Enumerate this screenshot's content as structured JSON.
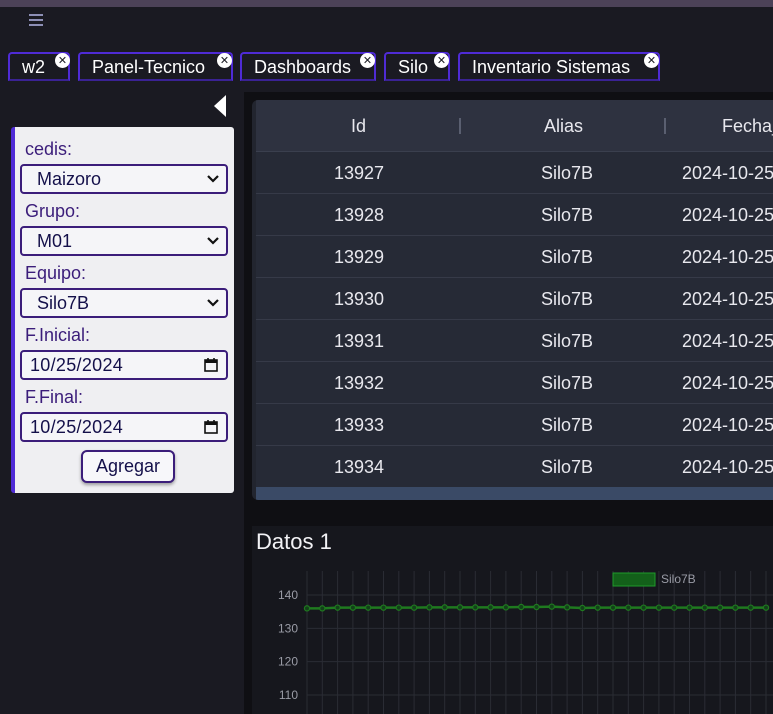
{
  "tabs": [
    {
      "label": "w2"
    },
    {
      "label": "Panel-Tecnico"
    },
    {
      "label": "Dashboards"
    },
    {
      "label": "Silo"
    },
    {
      "label": "Inventario Sistemas"
    }
  ],
  "filters": {
    "cedis_label": "cedis:",
    "cedis_value": "Maizoro",
    "grupo_label": "Grupo:",
    "grupo_value": "M01",
    "equipo_label": "Equipo:",
    "equipo_value": "Silo7B",
    "f_inicial_label": "F.Inicial:",
    "f_inicial_value": "10/25/2024",
    "f_final_label": "F.Final:",
    "f_final_value": "10/25/2024",
    "agregar_label": "Agregar"
  },
  "grid": {
    "columns": [
      "Id",
      "Alias",
      "Fecha_"
    ],
    "rows": [
      [
        "13927",
        "Silo7B",
        "2024-10-25"
      ],
      [
        "13928",
        "Silo7B",
        "2024-10-25"
      ],
      [
        "13929",
        "Silo7B",
        "2024-10-25"
      ],
      [
        "13930",
        "Silo7B",
        "2024-10-25"
      ],
      [
        "13931",
        "Silo7B",
        "2024-10-25"
      ],
      [
        "13932",
        "Silo7B",
        "2024-10-25"
      ],
      [
        "13933",
        "Silo7B",
        "2024-10-25"
      ],
      [
        "13934",
        "Silo7B",
        "2024-10-25"
      ]
    ]
  },
  "chart_data": {
    "type": "line",
    "title": "Datos 1",
    "y_ticks": [
      140,
      130,
      120,
      110
    ],
    "ylim": [
      105,
      145
    ],
    "grid": true,
    "legend_position": "top",
    "series": [
      {
        "name": "Silo7B",
        "color": "#1f7a1f",
        "values": [
          136,
          136,
          136.2,
          136.2,
          136.2,
          136.2,
          136.2,
          136.2,
          136.3,
          136.3,
          136.3,
          136.3,
          136.3,
          136.3,
          136.4,
          136.4,
          136.5,
          136.3,
          136.1,
          136.2,
          136.2,
          136.2,
          136.2,
          136.2,
          136.2,
          136.2,
          136.2,
          136.2,
          136.2,
          136.2,
          136.2
        ]
      }
    ]
  }
}
